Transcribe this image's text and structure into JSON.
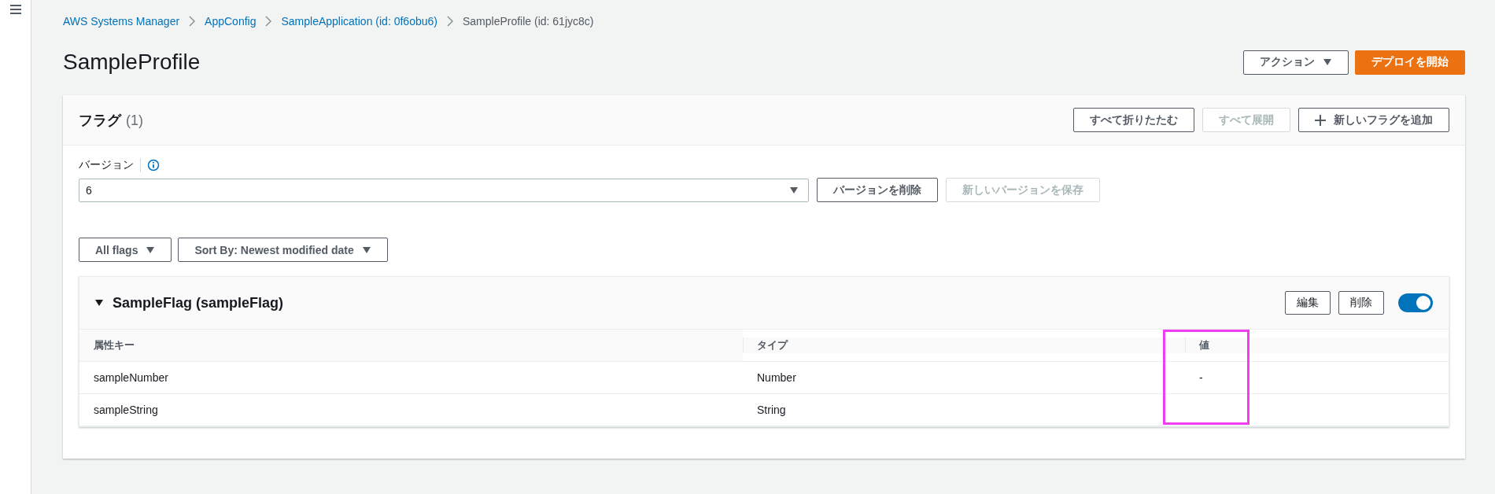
{
  "breadcrumb": [
    {
      "label": "AWS Systems Manager",
      "link": true
    },
    {
      "label": "AppConfig",
      "link": true
    },
    {
      "label": "SampleApplication (id: 0f6obu6)",
      "link": true
    },
    {
      "label": "SampleProfile (id: 61jyc8c)",
      "link": false
    }
  ],
  "title": "SampleProfile",
  "header_buttons": [
    {
      "label": "アクション",
      "kind": "dropdown"
    },
    {
      "label": "デプロイを開始",
      "kind": "primary"
    }
  ],
  "panel": {
    "title": "フラグ",
    "count": "(1)",
    "buttons": [
      {
        "label": "すべて折りたたむ",
        "disabled": false,
        "kind": "plain"
      },
      {
        "label": "すべて展開",
        "disabled": true,
        "kind": "plain"
      },
      {
        "label": "新しいフラグを追加",
        "disabled": false,
        "kind": "add"
      }
    ],
    "version": {
      "label": "バージョン",
      "value": "6",
      "buttons": [
        {
          "label": "バージョンを削除",
          "disabled": false
        },
        {
          "label": "新しいバージョンを保存",
          "disabled": true
        }
      ]
    },
    "filters": [
      {
        "label": "All flags"
      },
      {
        "label": "Sort By: Newest modified date"
      }
    ],
    "flags": [
      {
        "name": "SampleFlag (sampleFlag)",
        "expanded": true,
        "enabled": true,
        "buttons": [
          {
            "label": "編集"
          },
          {
            "label": "削除"
          }
        ],
        "columns": [
          {
            "label": "属性キー",
            "highlighted": false
          },
          {
            "label": "タイプ",
            "highlighted": false
          },
          {
            "label": "値",
            "highlighted": true
          }
        ],
        "rows": [
          [
            "sampleNumber",
            "Number",
            "-"
          ],
          [
            "sampleString",
            "String",
            ""
          ]
        ]
      }
    ]
  }
}
